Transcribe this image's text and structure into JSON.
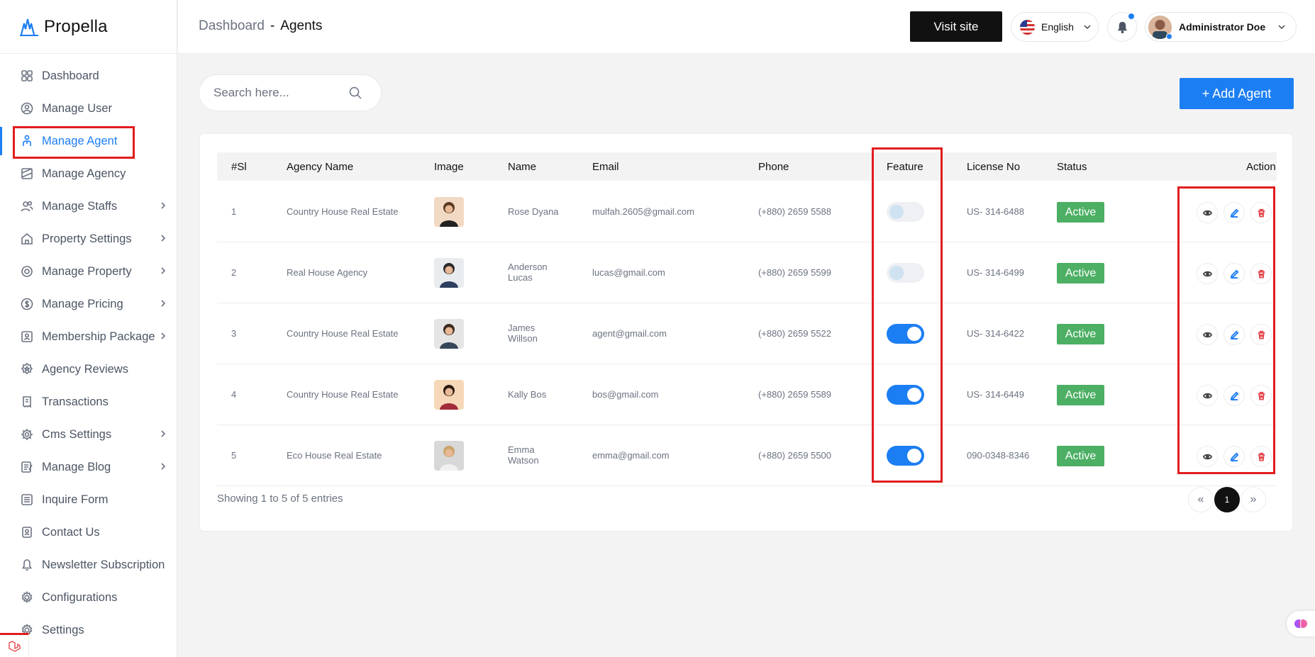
{
  "brand": {
    "name": "Propella"
  },
  "sidebar": {
    "items": [
      {
        "label": "Dashboard",
        "icon": "grid-icon",
        "has_submenu": false
      },
      {
        "label": "Manage User",
        "icon": "user-circle-icon",
        "has_submenu": false
      },
      {
        "label": "Manage Agent",
        "icon": "agent-icon",
        "has_submenu": false,
        "active": true
      },
      {
        "label": "Manage Agency",
        "icon": "building-icon",
        "has_submenu": false
      },
      {
        "label": "Manage Staffs",
        "icon": "users-icon",
        "has_submenu": true
      },
      {
        "label": "Property Settings",
        "icon": "home-icon",
        "has_submenu": true
      },
      {
        "label": "Manage Property",
        "icon": "cog-icon",
        "has_submenu": true
      },
      {
        "label": "Manage Pricing",
        "icon": "dollar-icon",
        "has_submenu": true
      },
      {
        "label": "Membership Package",
        "icon": "id-card-icon",
        "has_submenu": true
      },
      {
        "label": "Agency Reviews",
        "icon": "star-badge-icon",
        "has_submenu": false
      },
      {
        "label": "Transactions",
        "icon": "receipt-icon",
        "has_submenu": false
      },
      {
        "label": "Cms Settings",
        "icon": "settings-icon",
        "has_submenu": true
      },
      {
        "label": "Manage Blog",
        "icon": "blog-icon",
        "has_submenu": true
      },
      {
        "label": "Inquire Form",
        "icon": "list-icon",
        "has_submenu": false
      },
      {
        "label": "Contact Us",
        "icon": "contact-icon",
        "has_submenu": false
      },
      {
        "label": "Newsletter Subscription",
        "icon": "bell-icon",
        "has_submenu": false
      },
      {
        "label": "Configurations",
        "icon": "gear-icon",
        "has_submenu": false
      },
      {
        "label": "Settings",
        "icon": "gear-icon",
        "has_submenu": false
      }
    ]
  },
  "header": {
    "breadcrumb_root": "Dashboard",
    "breadcrumb_sep": "-",
    "breadcrumb_current": "Agents",
    "visit_site_label": "Visit site",
    "language": "English",
    "user_name": "Administrator Doe"
  },
  "search": {
    "placeholder": "Search here..."
  },
  "add_button_label": "+ Add Agent",
  "table": {
    "columns": [
      "#Sl",
      "Agency Name",
      "Image",
      "Name",
      "Email",
      "Phone",
      "Feature",
      "License No",
      "Status",
      "Action"
    ],
    "rows": [
      {
        "sl": "1",
        "agency": "Country House Real Estate",
        "name_line1": "Rose Dyana",
        "name_line2": "",
        "email": "mulfah.2605@gmail.com",
        "phone": "(+880) 2659 5588",
        "featured": false,
        "license": "US- 314-6488",
        "status": "Active"
      },
      {
        "sl": "2",
        "agency": "Real House Agency",
        "name_line1": "Anderson",
        "name_line2": "Lucas",
        "email": "lucas@gmail.com",
        "phone": "(+880) 2659 5599",
        "featured": false,
        "license": "US- 314-6499",
        "status": "Active"
      },
      {
        "sl": "3",
        "agency": "Country House Real Estate",
        "name_line1": "James",
        "name_line2": "Willson",
        "email": "agent@gmail.com",
        "phone": "(+880) 2659 5522",
        "featured": true,
        "license": "US- 314-6422",
        "status": "Active"
      },
      {
        "sl": "4",
        "agency": "Country House Real Estate",
        "name_line1": "Kally Bos",
        "name_line2": "",
        "email": "bos@gmail.com",
        "phone": "(+880) 2659 5589",
        "featured": true,
        "license": "US- 314-6449",
        "status": "Active"
      },
      {
        "sl": "5",
        "agency": "Eco House Real Estate",
        "name_line1": "Emma",
        "name_line2": "Watson",
        "email": "emma@gmail.com",
        "phone": "(+880) 2659 5500",
        "featured": true,
        "license": "090-0348-8346",
        "status": "Active"
      }
    ],
    "footer": "Showing 1 to 5 of 5 entries"
  },
  "pagination": {
    "prev": "«",
    "current": "1",
    "next": "»"
  },
  "colors": {
    "accent": "#1c7ef3",
    "active_badge": "#4caf64",
    "highlight": "#e11d1d",
    "delete": "#e5484d"
  }
}
